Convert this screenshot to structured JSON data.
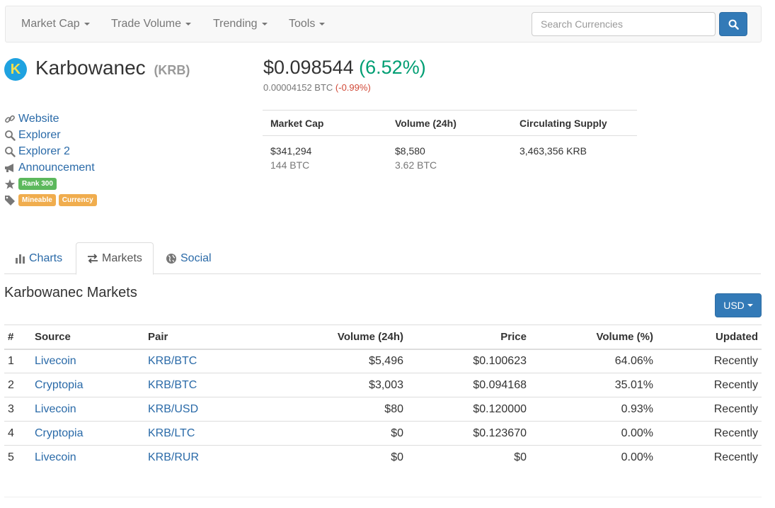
{
  "nav": {
    "items": [
      {
        "label": "Market Cap"
      },
      {
        "label": "Trade Volume"
      },
      {
        "label": "Trending"
      },
      {
        "label": "Tools"
      }
    ],
    "search_placeholder": "Search Currencies",
    "search_icon": "search-icon"
  },
  "coin": {
    "logo_letter": "K",
    "name": "Karbowanec",
    "symbol": "(KRB)",
    "price": "$0.098544",
    "price_change": "(6.52%)",
    "btc_price": "0.00004152 BTC",
    "btc_change": "(-0.99%)",
    "accent_color": "#009e73"
  },
  "links": {
    "website": "Website",
    "explorer": "Explorer",
    "explorer2": "Explorer 2",
    "announcement": "Announcement",
    "rank": "Rank 300",
    "tags": [
      "Mineable",
      "Currency"
    ]
  },
  "stats": {
    "headers": [
      "Market Cap",
      "Volume (24h)",
      "Circulating Supply"
    ],
    "market_cap_usd": "$341,294",
    "market_cap_btc": "144 BTC",
    "volume_usd": "$8,580",
    "volume_btc": "3.62 BTC",
    "supply": "3,463,356 KRB"
  },
  "tabs": [
    {
      "label": "Charts",
      "icon": "bar-chart-icon"
    },
    {
      "label": "Markets",
      "icon": "exchange-icon"
    },
    {
      "label": "Social",
      "icon": "globe-icon"
    }
  ],
  "markets": {
    "title": "Karbowanec Markets",
    "currency_button": "USD",
    "columns": [
      "#",
      "Source",
      "Pair",
      "Volume (24h)",
      "Price",
      "Volume (%)",
      "Updated"
    ],
    "rows": [
      {
        "rank": "1",
        "source": "Livecoin",
        "pair": "KRB/BTC",
        "volume": "$5,496",
        "price": "$0.100623",
        "volume_pct": "64.06%",
        "updated": "Recently"
      },
      {
        "rank": "2",
        "source": "Cryptopia",
        "pair": "KRB/BTC",
        "volume": "$3,003",
        "price": "$0.094168",
        "volume_pct": "35.01%",
        "updated": "Recently"
      },
      {
        "rank": "3",
        "source": "Livecoin",
        "pair": "KRB/USD",
        "volume": "$80",
        "price": "$0.120000",
        "volume_pct": "0.93%",
        "updated": "Recently"
      },
      {
        "rank": "4",
        "source": "Cryptopia",
        "pair": "KRB/LTC",
        "volume": "$0",
        "price": "$0.123670",
        "volume_pct": "0.00%",
        "updated": "Recently"
      },
      {
        "rank": "5",
        "source": "Livecoin",
        "pair": "KRB/RUR",
        "volume": "$0",
        "price": "$0",
        "volume_pct": "0.00%",
        "updated": "Recently"
      }
    ]
  }
}
